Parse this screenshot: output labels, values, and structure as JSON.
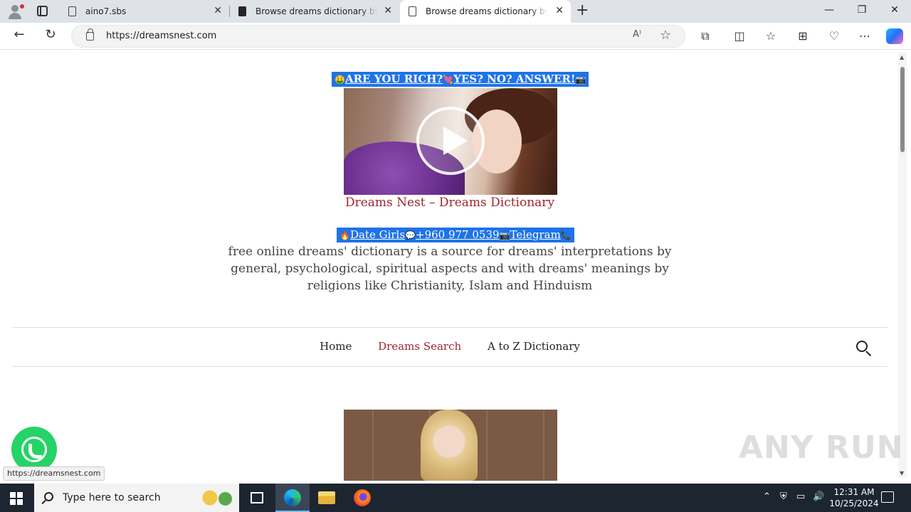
{
  "browser": {
    "tabs": [
      {
        "title": "aino7.sbs",
        "close": "✕"
      },
      {
        "title": "Browse dreams dictionary by search",
        "close": "✕"
      },
      {
        "title": "Browse dreams dictionary by search",
        "close": "✕"
      }
    ],
    "new_tab": "+",
    "window_controls": {
      "minimize": "—",
      "restore": "❐",
      "close": "✕"
    },
    "url": "https://dreamsnest.com",
    "read_aloud": "A⁾",
    "favorite_star": "☆",
    "toolbar_icons": [
      "extensions-icon",
      "split-screen-icon",
      "favorites-icon",
      "collections-icon",
      "browser-essentials-icon",
      "more-icon"
    ]
  },
  "page": {
    "promo_top": {
      "lead_emoji": "🤑",
      "text1": "ARE YOU RICH?",
      "mid_emoji": "💘",
      "text2": "YES? NO? ANSWER!",
      "tail_emoji": "📷"
    },
    "site_title": "Dreams Nest – Dreams Dictionary",
    "promo_mid": {
      "lead_emoji": "🔥",
      "text1": "Date Girls",
      "mid_emoji": "💬",
      "text2": "+960 977 0539",
      "mid_emoji2": "📷",
      "text3": "Telegram",
      "tail_emoji": "📞"
    },
    "tagline": "free online dreams' dictionary is a source for dreams' interpretations by general, psychological, spiritual aspects and with dreams' meanings by religions like Christianity, Islam and Hinduism",
    "menu": [
      {
        "label": "Home"
      },
      {
        "label": "Dreams Search"
      },
      {
        "label": "A to Z Dictionary"
      }
    ]
  },
  "status_bar_url": "https://dreamsnest.com",
  "watermark": "ANY RUN",
  "taskbar": {
    "search_placeholder": "Type here to search",
    "time": "12:31 AM",
    "date": "10/25/2024"
  },
  "colors": {
    "accent_red": "#a0262e",
    "promo_blue": "#1e73e8",
    "taskbar": "#1c2530",
    "whatsapp": "#25d366"
  }
}
